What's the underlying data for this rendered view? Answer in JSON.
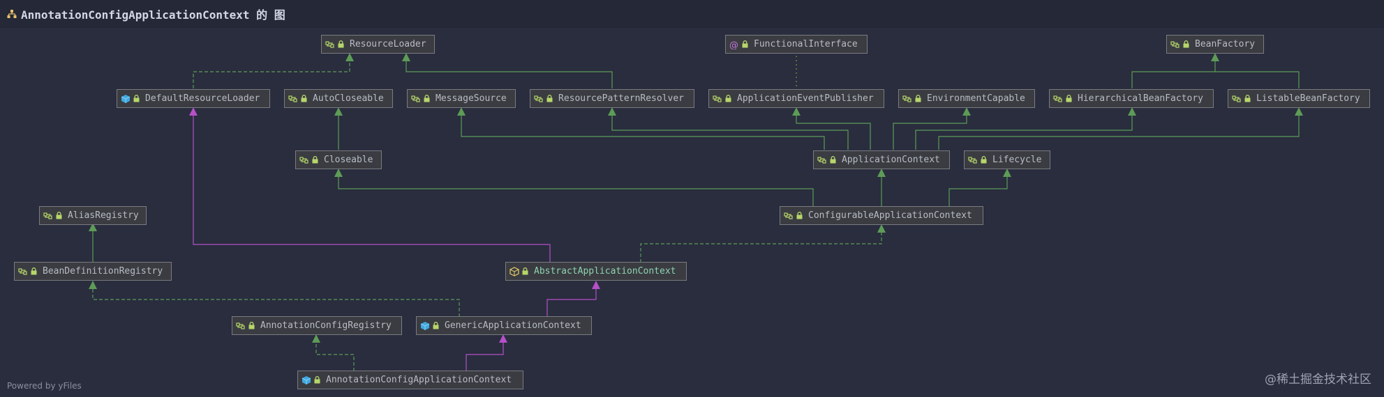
{
  "header": {
    "title": "AnnotationConfigApplicationContext 的 图",
    "icon": "class-hierarchy-icon"
  },
  "nodes": {
    "resource_loader": {
      "label": "ResourceLoader",
      "kind": "interface"
    },
    "functional_interface": {
      "label": "FunctionalInterface",
      "kind": "annotation"
    },
    "bean_factory": {
      "label": "BeanFactory",
      "kind": "interface"
    },
    "default_resource_loader": {
      "label": "DefaultResourceLoader",
      "kind": "class"
    },
    "auto_closeable": {
      "label": "AutoCloseable",
      "kind": "interface"
    },
    "message_source": {
      "label": "MessageSource",
      "kind": "interface"
    },
    "resource_pattern_resolver": {
      "label": "ResourcePatternResolver",
      "kind": "interface"
    },
    "application_event_publisher": {
      "label": "ApplicationEventPublisher",
      "kind": "interface"
    },
    "environment_capable": {
      "label": "EnvironmentCapable",
      "kind": "interface"
    },
    "hierarchical_bean_factory": {
      "label": "HierarchicalBeanFactory",
      "kind": "interface"
    },
    "listable_bean_factory": {
      "label": "ListableBeanFactory",
      "kind": "interface"
    },
    "closeable": {
      "label": "Closeable",
      "kind": "interface"
    },
    "application_context": {
      "label": "ApplicationContext",
      "kind": "interface"
    },
    "lifecycle": {
      "label": "Lifecycle",
      "kind": "interface"
    },
    "alias_registry": {
      "label": "AliasRegistry",
      "kind": "interface"
    },
    "configurable_application_context": {
      "label": "ConfigurableApplicationContext",
      "kind": "interface"
    },
    "bean_definition_registry": {
      "label": "BeanDefinitionRegistry",
      "kind": "interface"
    },
    "abstract_application_context": {
      "label": "AbstractApplicationContext",
      "kind": "abstract-class"
    },
    "annotation_config_registry": {
      "label": "AnnotationConfigRegistry",
      "kind": "interface"
    },
    "generic_application_context": {
      "label": "GenericApplicationContext",
      "kind": "class"
    },
    "annotation_config_application_context": {
      "label": "AnnotationConfigApplicationContext",
      "kind": "class"
    }
  },
  "colors": {
    "background": "#292d3e",
    "extends_edge": "#5e9b57",
    "implements_edge": "#5e9b57",
    "class_extends_edge": "#b550c8",
    "annotation_edge": "#7d8a3c"
  },
  "footer": {
    "text": "Powered by yFiles"
  },
  "watermark": {
    "text": "@稀土掘金技术社区"
  }
}
